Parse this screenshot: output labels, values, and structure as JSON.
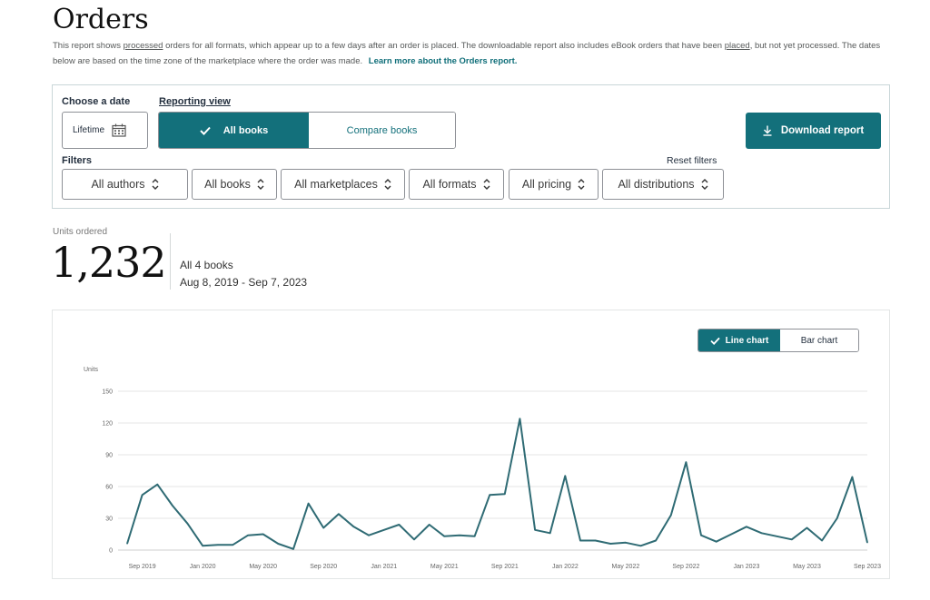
{
  "header": {
    "title": "Orders",
    "intro_part1": "This report shows ",
    "intro_link1": "processed",
    "intro_part2": " orders for all formats, which appear up to a few days after an order is placed. The downloadable report also includes eBook orders that have been ",
    "intro_link2": "placed",
    "intro_part3": ", but not yet processed. The dates below are based on the time zone of the marketplace where the order was made.",
    "learn_more": "Learn more about the Orders report."
  },
  "filters": {
    "choose_date_label": "Choose a date",
    "date_value": "Lifetime",
    "reporting_view_label": "Reporting view",
    "view_all": "All books",
    "view_compare": "Compare books",
    "download": "Download report",
    "filters_label": "Filters",
    "reset": "Reset filters",
    "selects": [
      "All authors",
      "All books",
      "All marketplaces",
      "All formats",
      "All pricing",
      "All distributions"
    ]
  },
  "summary": {
    "label": "Units ordered",
    "value": "1,232",
    "books": "All 4 books",
    "range": "Aug 8, 2019 - Sep 7, 2023"
  },
  "chart_toggle": {
    "line": "Line chart",
    "bar": "Bar chart"
  },
  "colors": {
    "accent": "#13707b",
    "line": "#2f6b74",
    "grid": "#e6e6e6"
  },
  "chart_data": {
    "type": "line",
    "ylabel": "Units",
    "ylim": [
      0,
      150
    ],
    "yticks": [
      0,
      30,
      60,
      90,
      120,
      150
    ],
    "xtick_labels": [
      "Sep 2019",
      "Jan 2020",
      "May 2020",
      "Sep 2020",
      "Jan 2021",
      "May 2021",
      "Sep 2021",
      "Jan 2022",
      "May 2022",
      "Sep 2022",
      "Jan 2023",
      "May 2023",
      "Sep 2023"
    ],
    "xtick_index": [
      1,
      5,
      9,
      13,
      17,
      21,
      25,
      29,
      33,
      37,
      41,
      45,
      49
    ],
    "x": [
      "Aug 2019",
      "Sep 2019",
      "Oct 2019",
      "Nov 2019",
      "Dec 2019",
      "Jan 2020",
      "Feb 2020",
      "Mar 2020",
      "Apr 2020",
      "May 2020",
      "Jun 2020",
      "Jul 2020",
      "Aug 2020",
      "Sep 2020",
      "Oct 2020",
      "Nov 2020",
      "Dec 2020",
      "Jan 2021",
      "Feb 2021",
      "Mar 2021",
      "Apr 2021",
      "May 2021",
      "Jun 2021",
      "Jul 2021",
      "Aug 2021",
      "Sep 2021",
      "Oct 2021",
      "Nov 2021",
      "Dec 2021",
      "Jan 2022",
      "Feb 2022",
      "Mar 2022",
      "Apr 2022",
      "May 2022",
      "Jun 2022",
      "Jul 2022",
      "Aug 2022",
      "Sep 2022",
      "Oct 2022",
      "Nov 2022",
      "Dec 2022",
      "Jan 2023",
      "Feb 2023",
      "Mar 2023",
      "Apr 2023",
      "May 2023",
      "Jun 2023",
      "Jul 2023",
      "Aug 2023",
      "Sep 2023"
    ],
    "series": [
      {
        "values": [
          6,
          52,
          62,
          42,
          25,
          4,
          5,
          5,
          14,
          15,
          6,
          1,
          44,
          21,
          34,
          22,
          14,
          19,
          24,
          10,
          24,
          13,
          14,
          13,
          52,
          53,
          124,
          19,
          16,
          70,
          9,
          9,
          6,
          7,
          4,
          9,
          33,
          83,
          14,
          8,
          15,
          22,
          16,
          13,
          10,
          21,
          9,
          30,
          69,
          7
        ]
      }
    ]
  }
}
